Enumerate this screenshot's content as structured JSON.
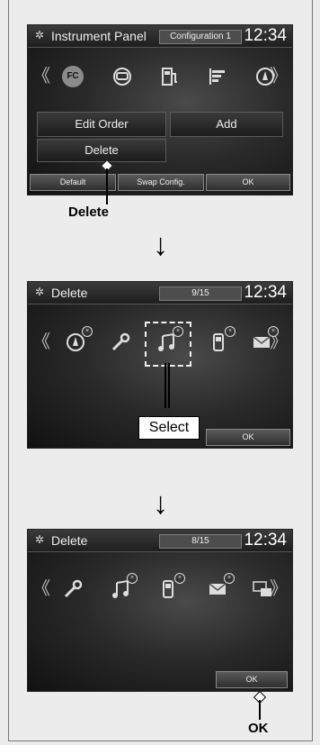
{
  "screen1": {
    "title": "Instrument Panel",
    "config": "Configuration 1",
    "clock": "12:34",
    "icons": [
      "fc-icon",
      "steering-wheel-icon",
      "fuel-pump-icon",
      "bar-list-icon",
      "compass-icon"
    ],
    "fc_label": "FC",
    "edit_order": "Edit Order",
    "add": "Add",
    "delete": "Delete",
    "default": "Default",
    "swap": "Swap Config.",
    "ok": "OK"
  },
  "callout1": "Delete",
  "screen2": {
    "title": "Delete",
    "count": "9/15",
    "clock": "12:34",
    "ok": "OK"
  },
  "callout2": "Select",
  "screen3": {
    "title": "Delete",
    "count": "8/15",
    "clock": "12:34",
    "ok": "OK"
  },
  "callout3": "OK",
  "glyphs": {
    "gear": "✲",
    "left": "《",
    "right": "》",
    "x": "×",
    "down": "↓"
  }
}
